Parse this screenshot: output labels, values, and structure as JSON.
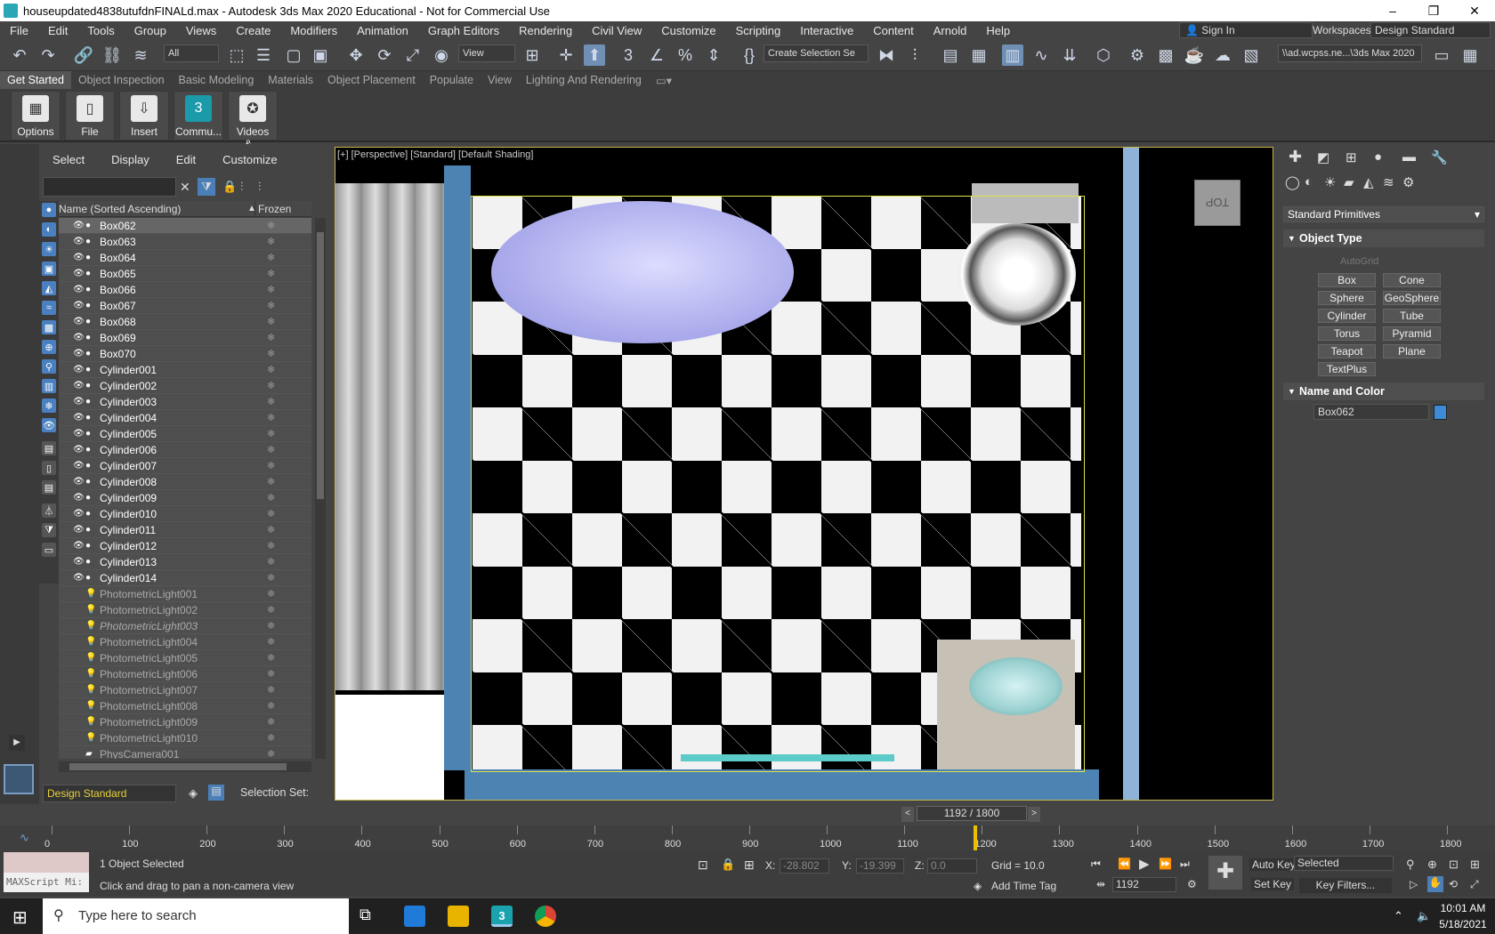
{
  "window": {
    "title": "houseupdated4838utufdnFINALd.max - Autodesk 3ds Max 2020 Educational - Not for Commercial Use",
    "controls": [
      "–",
      "❐",
      "✕"
    ]
  },
  "menu": [
    "File",
    "Edit",
    "Tools",
    "Group",
    "Views",
    "Create",
    "Modifiers",
    "Animation",
    "Graph Editors",
    "Rendering",
    "Civil View",
    "Customize",
    "Scripting",
    "Interactive",
    "Content",
    "Arnold",
    "Help"
  ],
  "account": {
    "sign_in": "Sign In",
    "workspaces_label": "Workspaces:",
    "workspace": "Design Standard"
  },
  "toolbar": {
    "filter": "All",
    "ref_coord": "View",
    "named_selection": "Create Selection Se",
    "project_path": "\\\\ad.wcpss.ne...\\3ds Max 2020"
  },
  "ribbon_tabs": [
    "Get Started",
    "Object Inspection",
    "Basic Modeling",
    "Materials",
    "Object Placement",
    "Populate",
    "View",
    "Lighting And Rendering"
  ],
  "ribbon_buttons": [
    "Options",
    "File",
    "Insert",
    "Commu...",
    "Videos &..."
  ],
  "scene_explorer": {
    "menu": [
      "Select",
      "Display",
      "Edit",
      "Customize"
    ],
    "col_name": "Name (Sorted Ascending)",
    "col_frozen": "Frozen",
    "items": [
      "Box062",
      "Box063",
      "Box064",
      "Box065",
      "Box066",
      "Box067",
      "Box068",
      "Box069",
      "Box070",
      "Cylinder001",
      "Cylinder002",
      "Cylinder003",
      "Cylinder004",
      "Cylinder005",
      "Cylinder006",
      "Cylinder007",
      "Cylinder008",
      "Cylinder009",
      "Cylinder010",
      "Cylinder011",
      "Cylinder012",
      "Cylinder013",
      "Cylinder014",
      "PhotometricLight001",
      "PhotometricLight002",
      "PhotometricLight003",
      "PhotometricLight004",
      "PhotometricLight005",
      "PhotometricLight006",
      "PhotometricLight007",
      "PhotometricLight008",
      "PhotometricLight009",
      "PhotometricLight010",
      "PhysCamera001"
    ],
    "layer": "Design Standard",
    "selection_set": "Selection Set:"
  },
  "viewport": {
    "label": "[+] [Perspective] [Standard] [Default Shading]",
    "viewcube": "TOP"
  },
  "command_panel": {
    "category": "Standard Primitives",
    "object_type": "Object Type",
    "autogrid": "AutoGrid",
    "primitives": [
      "Box",
      "Cone",
      "Sphere",
      "GeoSphere",
      "Cylinder",
      "Tube",
      "Torus",
      "Pyramid",
      "Teapot",
      "Plane",
      "TextPlus"
    ],
    "name_and_color": "Name and Color",
    "object_name": "Box062",
    "object_color": "#3d8ad6"
  },
  "timeline": {
    "frame": "1192 / 1800",
    "current": 1192,
    "total": 1800,
    "ticks": [
      "0",
      "100",
      "200",
      "300",
      "400",
      "500",
      "600",
      "700",
      "800",
      "900",
      "1000",
      "1100",
      "1200",
      "1300",
      "1400",
      "1500",
      "1600",
      "1700",
      "1800"
    ]
  },
  "status": {
    "selected": "1 Object Selected",
    "prompt": "Click and drag to pan a non-camera view",
    "maxscript": "MAXScript Mi:",
    "x_label": "X:",
    "x": "-28.802",
    "y_label": "Y:",
    "y": "-19.399",
    "z_label": "Z:",
    "z": "0.0",
    "grid": "Grid = 10.0",
    "add_time_tag": "Add Time Tag",
    "auto_key": "Auto Key",
    "key_filter": "Selected",
    "set_key": "Set Key",
    "key_filters": "Key Filters...",
    "frame_field": "1192"
  },
  "taskbar": {
    "search": "Type here to search",
    "time": "10:01 AM",
    "date": "5/18/2021"
  }
}
